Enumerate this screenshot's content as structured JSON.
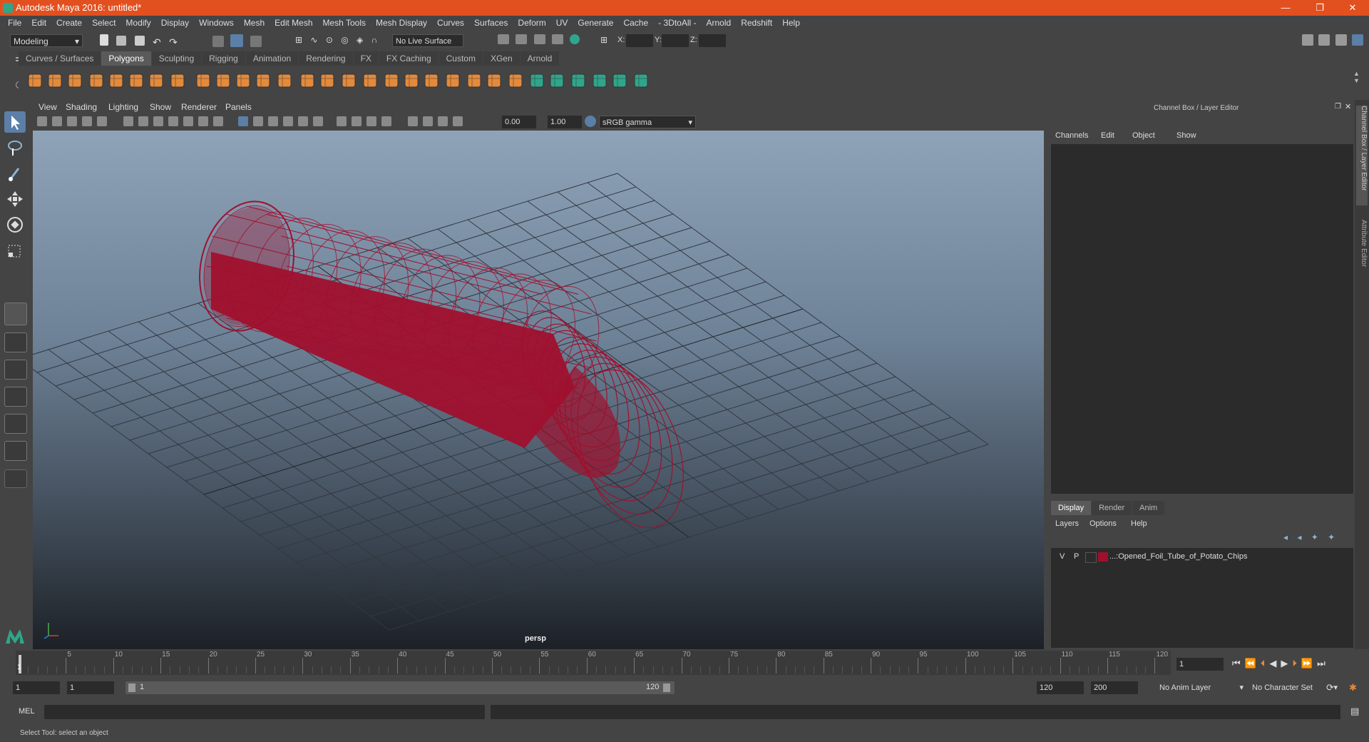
{
  "window": {
    "title": "Autodesk Maya 2016: untitled*",
    "controls": {
      "minimize": "—",
      "restore": "❐",
      "close": "✕"
    }
  },
  "menubar": [
    "File",
    "Edit",
    "Create",
    "Select",
    "Modify",
    "Display",
    "Windows",
    "Mesh",
    "Edit Mesh",
    "Mesh Tools",
    "Mesh Display",
    "Curves",
    "Surfaces",
    "Deform",
    "UV",
    "Generate",
    "Cache",
    "- 3DtoAll -",
    "Arnold",
    "Redshift",
    "Help"
  ],
  "statusline": {
    "mode": "Modeling",
    "live_surface": "No Live Surface",
    "x_label": "X:",
    "y_label": "Y:",
    "z_label": "Z:"
  },
  "shelf": {
    "tabs": [
      "Curves / Surfaces",
      "Polygons",
      "Sculpting",
      "Rigging",
      "Animation",
      "Rendering",
      "FX",
      "FX Caching",
      "Custom",
      "XGen",
      "Arnold"
    ],
    "active_tab": "Polygons"
  },
  "viewport": {
    "menu": [
      "View",
      "Shading",
      "Lighting",
      "Show",
      "Renderer",
      "Panels"
    ],
    "exposure": "0.00",
    "gamma": "1.00",
    "color_space": "sRGB gamma",
    "camera_label": "persp"
  },
  "channel_box": {
    "title": "Channel Box / Layer Editor",
    "menu": [
      "Channels",
      "Edit",
      "Object",
      "Show"
    ]
  },
  "layer_editor": {
    "tabs": [
      "Display",
      "Render",
      "Anim"
    ],
    "active_tab": "Display",
    "menu": [
      "Layers",
      "Options",
      "Help"
    ],
    "layers": [
      {
        "visible": "V",
        "playback": "P",
        "name": "...:Opened_Foil_Tube_of_Potato_Chips",
        "color": "#a0102e"
      }
    ]
  },
  "side_tabs": [
    "Channel Box / Layer Editor",
    "Attribute Editor"
  ],
  "timeline": {
    "ticks": [
      "5",
      "10",
      "15",
      "20",
      "25",
      "30",
      "35",
      "40",
      "45",
      "50",
      "55",
      "60",
      "65",
      "70",
      "75",
      "80",
      "85",
      "90",
      "95",
      "100",
      "105",
      "110",
      "115",
      "120"
    ],
    "start_marker": "1",
    "current_frame": "1"
  },
  "range": {
    "start": "1",
    "playback_start": "1",
    "slider_start": "1",
    "slider_end": "120",
    "playback_end": "120",
    "end": "200",
    "anim_layer": "No Anim Layer",
    "character_set": "No Character Set"
  },
  "command_line": {
    "label": "MEL"
  },
  "help_line": "Select Tool: select an object",
  "colors": {
    "titlebar": "#e2501f",
    "wireframe": "#a0102e",
    "shelf_icon": "#e38a3c",
    "accent_green": "#2fa58a"
  }
}
